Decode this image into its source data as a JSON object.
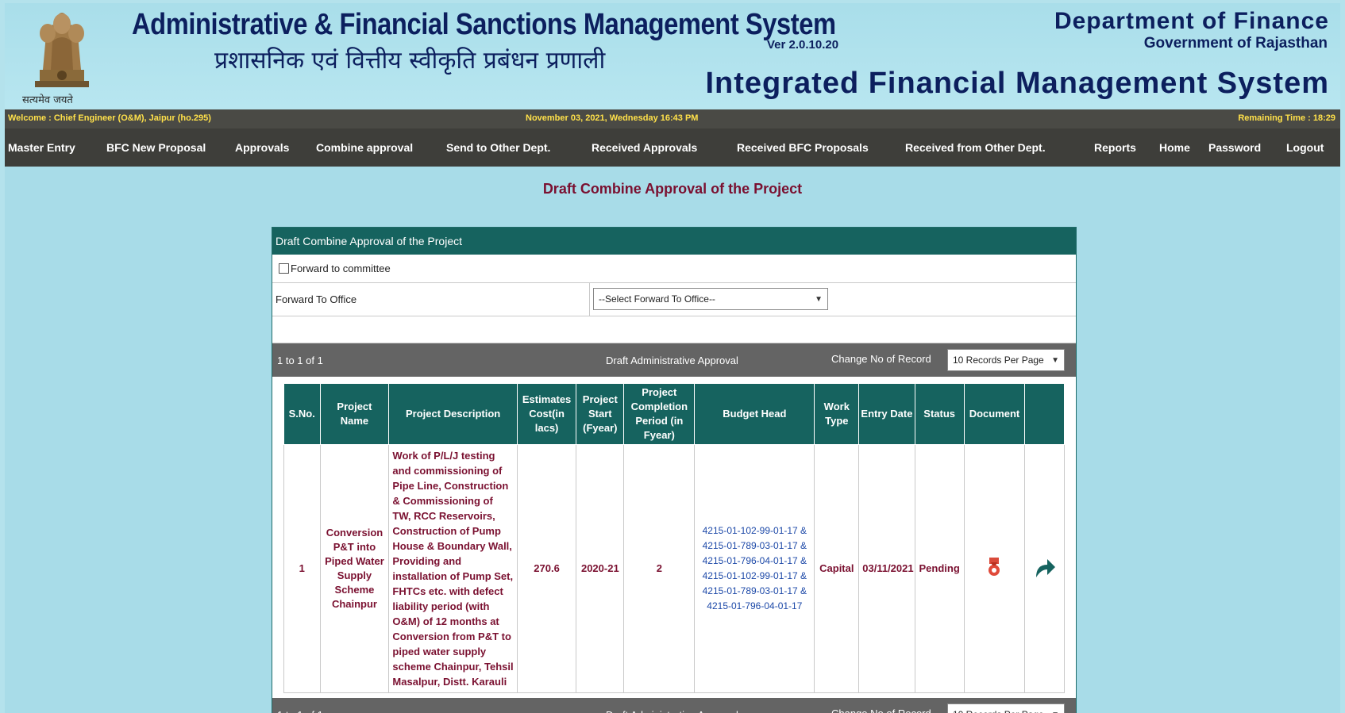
{
  "header": {
    "title": "Administrative & Financial Sanctions Management System",
    "version": "Ver 2.0.10.20",
    "hindi_title": "प्रशासनिक एवं वित्तीय स्वीकृति प्रबंधन प्रणाली",
    "emblem_motto": "सत्यमेव जयते",
    "department": "Department of Finance",
    "government": "Government of Rajasthan",
    "system_name": "Integrated Financial Management System"
  },
  "infobar": {
    "welcome": "Welcome : Chief Engineer (O&amp;M), Jaipur (ho.295)",
    "datetime": "November 03, 2021, Wednesday 16:43 PM",
    "remaining": "Remaining Time : 18:29"
  },
  "nav": {
    "items": [
      "Master Entry",
      "BFC New Proposal",
      "Approvals",
      "Combine approval",
      "Send to Other Dept.",
      "Received Approvals",
      "Received BFC Proposals",
      "Received from Other Dept.",
      "Reports",
      "Home",
      "Password",
      "Logout"
    ]
  },
  "page_title": "Draft Combine Approval of the Project",
  "panel": {
    "heading": "Draft Combine Approval of the Project",
    "forward_checkbox_label": "Forward to committee",
    "forward_office_label": "Forward To Office",
    "forward_office_select": "--Select Forward To Office--"
  },
  "pager": {
    "count": "1 to 1 of 1",
    "title": "Draft Administrative Approval",
    "change_label": "Change No of Record",
    "records_per_page": "10 Records Per Page"
  },
  "table": {
    "columns": [
      "S.No.",
      "Project Name",
      "Project Description",
      "Estimates Cost(in lacs)",
      "Project Start (Fyear)",
      "Project Completion Period (in Fyear)",
      "Budget Head",
      "Work Type",
      "Entry Date",
      "Status",
      "Document",
      ""
    ],
    "rows": [
      {
        "sno": "1",
        "project_name": "Conversion P&T into Piped Water Supply Scheme Chainpur",
        "description": "Work of P/L/J testing and commissioning of Pipe Line, Construction & Commissioning of TW, RCC Reservoirs, Construction of Pump House & Boundary Wall, Providing and installation of Pump Set, FHTCs etc. with defect liability period (with O&M) of 12 months at Conversion from P&T to piped water supply scheme Chainpur, Tehsil Masalpur, Distt. Karauli",
        "cost": "270.6",
        "start": "2020-21",
        "completion": "2",
        "budget_head": "4215-01-102-99-01-17 & 4215-01-789-03-01-17 & 4215-01-796-04-01-17 & 4215-01-102-99-01-17 & 4215-01-789-03-01-17 & 4215-01-796-04-01-17",
        "work_type": "Capital",
        "entry_date": "03/11/2021",
        "status": "Pending"
      }
    ]
  },
  "icons": {
    "document": "pdf-icon",
    "action": "forward-arrow-icon"
  },
  "colors": {
    "header_bg": "#a9deea",
    "title_text": "#0c1f5e",
    "nav_bg": "#3e3e3a",
    "panel_head": "#16635f",
    "pager_bg": "#646464",
    "row_text": "#7a1030",
    "budget_text": "#1d49a8"
  }
}
